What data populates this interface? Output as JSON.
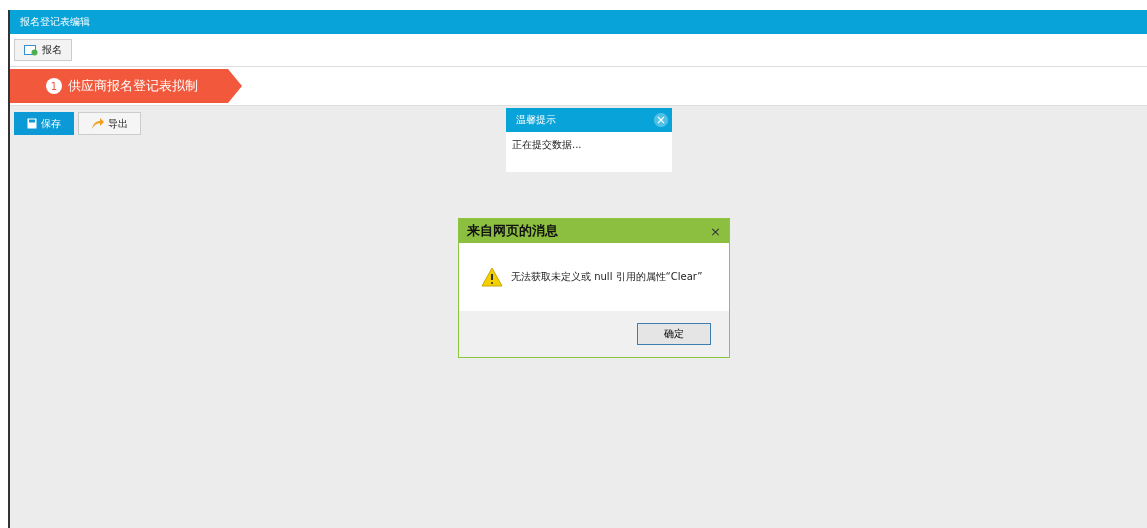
{
  "window": {
    "title": "报名登记表编辑"
  },
  "toolbar": {
    "buttons": [
      "报名"
    ]
  },
  "steps": [
    {
      "number": "1",
      "label": "供应商报名登记表拟制",
      "selected": true
    }
  ],
  "actions": [
    {
      "label": "保存",
      "kind": "primary"
    },
    {
      "label": "导出",
      "kind": "plain"
    }
  ],
  "tip_popup": {
    "title": "温馨提示",
    "message": "正在提交数据..."
  },
  "alert_dialog": {
    "title": "来自网页的消息",
    "close": "×",
    "message": "无法获取未定义或 null 引用的属性“Clear”",
    "ok_button": "确定"
  }
}
